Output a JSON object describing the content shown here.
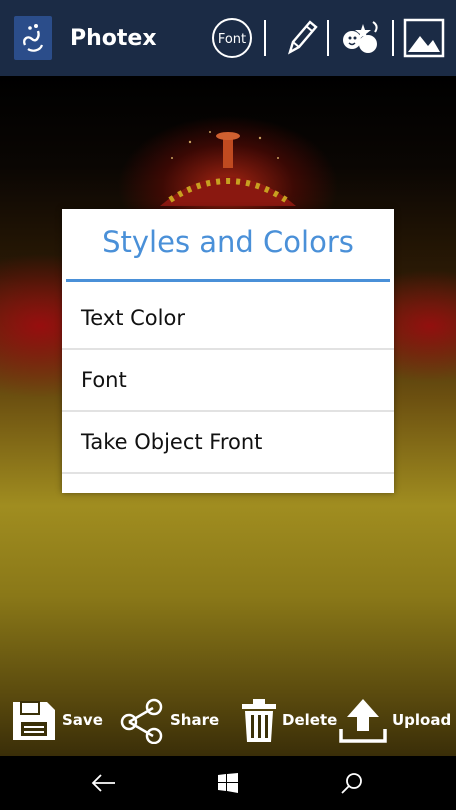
{
  "app": {
    "title": "Photex",
    "logo_icon": "calligraphy-logo-icon",
    "font_button_label": "Font"
  },
  "toolbar": {
    "items": [
      {
        "name": "font-icon",
        "label": "Font"
      },
      {
        "name": "pencil-icon"
      },
      {
        "name": "stickers-icon"
      },
      {
        "name": "image-icon"
      }
    ]
  },
  "dialog": {
    "title": "Styles and Colors",
    "items": [
      {
        "label": "Text Color"
      },
      {
        "label": "Font"
      },
      {
        "label": "Take Object Front"
      }
    ]
  },
  "actions": {
    "save": "Save",
    "share": "Share",
    "delete": "Delete",
    "upload": "Upload"
  },
  "navigation": {
    "back_icon": "back-arrow-icon",
    "home_icon": "windows-icon",
    "search_icon": "search-icon"
  },
  "colors": {
    "topbar": "#1b2b45",
    "accent": "#4a90d8"
  }
}
